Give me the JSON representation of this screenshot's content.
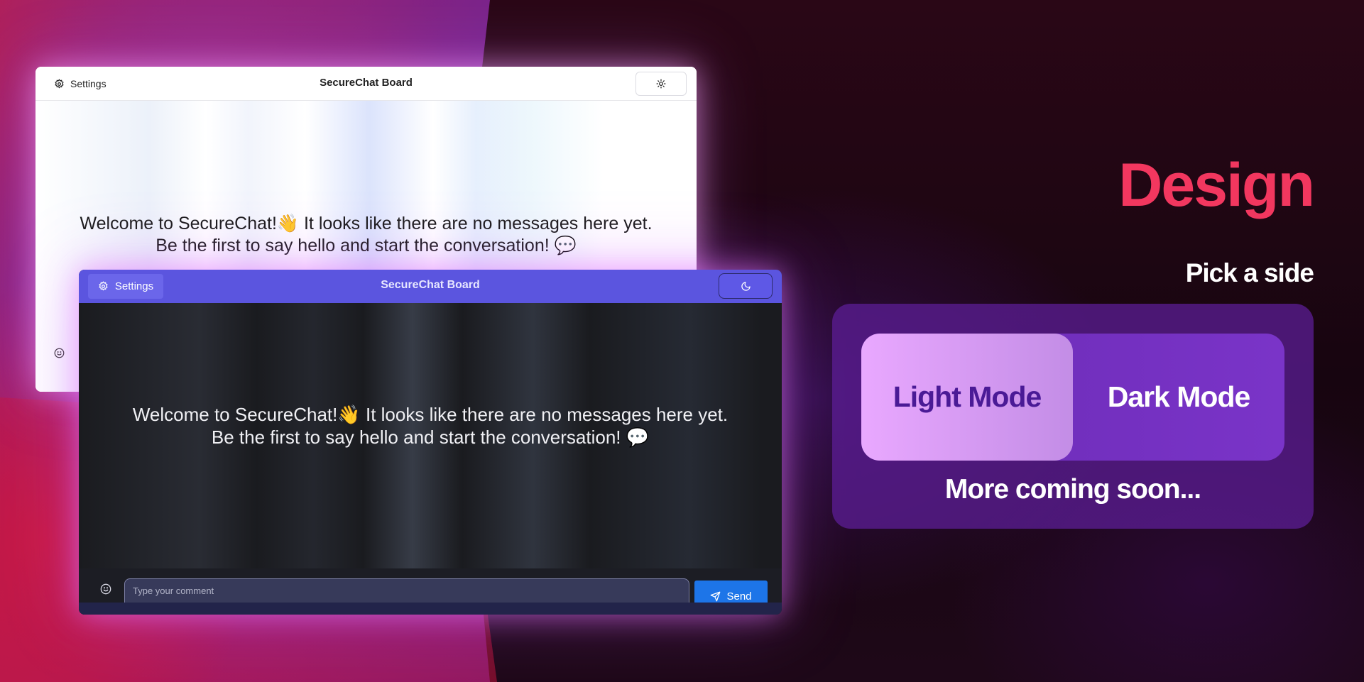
{
  "light_window": {
    "settings_label": "Settings",
    "title": "SecureChat Board",
    "welcome_line1": "Welcome to SecureChat!👋 It looks like there are no messages here yet.",
    "welcome_line2": "Be the first to say hello and start the conversation! 💬"
  },
  "dark_window": {
    "settings_label": "Settings",
    "title": "SecureChat Board",
    "welcome_line1": "Welcome to SecureChat!👋 It looks like there are no messages here yet.",
    "welcome_line2": "Be the first to say hello and start the conversation! 💬",
    "comment_placeholder": "Type your comment",
    "send_label": "Send"
  },
  "promo": {
    "heading": "Design",
    "subheading": "Pick a side",
    "light_mode_label": "Light Mode",
    "dark_mode_label": "Dark Mode",
    "footer": "More coming soon..."
  },
  "colors": {
    "accent_red": "#f2375f",
    "dark_titlebar": "#5b55df",
    "send_button": "#1d75e8",
    "panel_purple": "#5c1e96"
  },
  "icons": {
    "settings": "gear-icon",
    "light_mode": "sun-icon",
    "dark_mode": "moon-icon",
    "emoji": "smiley-icon",
    "send": "paper-plane-icon"
  }
}
